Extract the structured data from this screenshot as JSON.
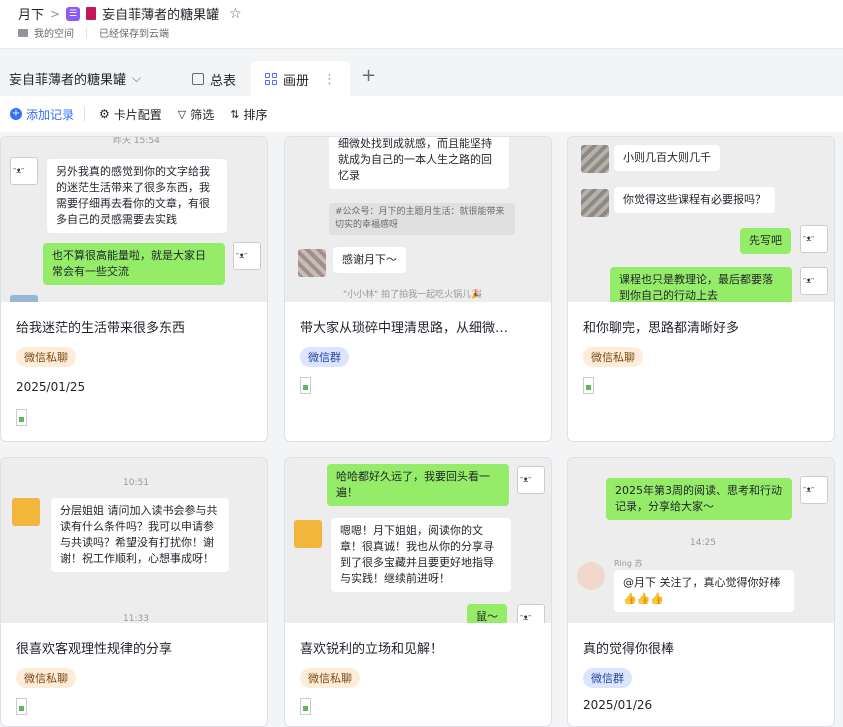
{
  "breadcrumb": {
    "parent": "月下",
    "sep": ">",
    "doc_icon": "list-icon",
    "book_icon": "book-icon",
    "doc_title": "妄自菲薄者的糖果罐",
    "star": "☆"
  },
  "subline": {
    "space": "我的空间",
    "status": "已经保存到云端"
  },
  "table": {
    "name": "妄自菲薄者的糖果罐",
    "chevron": "⌵"
  },
  "tabs": [
    {
      "label": "总表",
      "icon": "grid-icon"
    },
    {
      "label": "画册",
      "icon": "gallery-icon",
      "more": "⋮"
    }
  ],
  "add_tab": "+",
  "toolbar": {
    "add": "添加记录",
    "card_config": "卡片配置",
    "filter": "筛选",
    "sort": "排序"
  },
  "cards": [
    {
      "title": "给我迷茫的生活带来很多东西",
      "tag": "微信私聊",
      "date": "2025/01/25",
      "cover": {
        "ts": "昨天 15:54",
        "b1": "另外我真的感觉到你的文字给我的迷茫生活带来了很多东西，我需要仔细再去看你的文章，有很多自己的灵感需要去实践",
        "b2": "也不算很高能量啦，就是大家日常会有一些交流"
      }
    },
    {
      "title": "带大家从琐碎中理清思路，从细微…",
      "tag": "微信群",
      "date": "",
      "cover": {
        "b1": "细微处找到成就感，而且能坚持就成为自己的一本人生之路的回忆录",
        "quote": "#公众号：月下的主题月生活：就很能带来切实的幸福感呀",
        "b2": "感谢月下～",
        "sys": "\"小小林\" 拍了拍我一起吃火锅儿🎉"
      }
    },
    {
      "title": "和你聊完，思路都清晰好多",
      "tag": "微信私聊",
      "date": "",
      "cover": {
        "b1": "小则几百大则几千",
        "b2": "你觉得这些课程有必要报吗？",
        "b3": "先写吧",
        "b4": "课程也只是教理论，最后都要落到你自己的行动上去"
      }
    },
    {
      "title": "很喜欢客观理性规律的分享",
      "tag": "微信私聊",
      "date": "",
      "cover": {
        "ts": "10:51",
        "b1": "分层姐姐 请问加入读书会参与共读有什么条件吗？我可以申请参与共读吗？希望没有打扰你！谢谢！祝工作顺利，心想事成呀！",
        "ts2": "11:33"
      }
    },
    {
      "title": "喜欢锐利的立场和见解！",
      "tag": "微信私聊",
      "date": "",
      "cover": {
        "b1": "哈哈都好久远了，我要回头看一遍！",
        "b2": "嗯嗯！月下姐姐，阅读你的文章！很真诚！我也从你的分享寻到了很多宝藏并且要更好地指导与实践！继续前进呀！",
        "b3": "鼠～"
      }
    },
    {
      "title": "真的觉得你很棒",
      "tag": "微信群",
      "date": "2025/01/26",
      "cover": {
        "b1": "2025年第3周的阅读、思考和行动记录，分享给大家～",
        "ts": "14:25",
        "name": "Ring 苏",
        "b2": "@月下 关注了，真心觉得你好棒👍👍👍"
      }
    }
  ]
}
